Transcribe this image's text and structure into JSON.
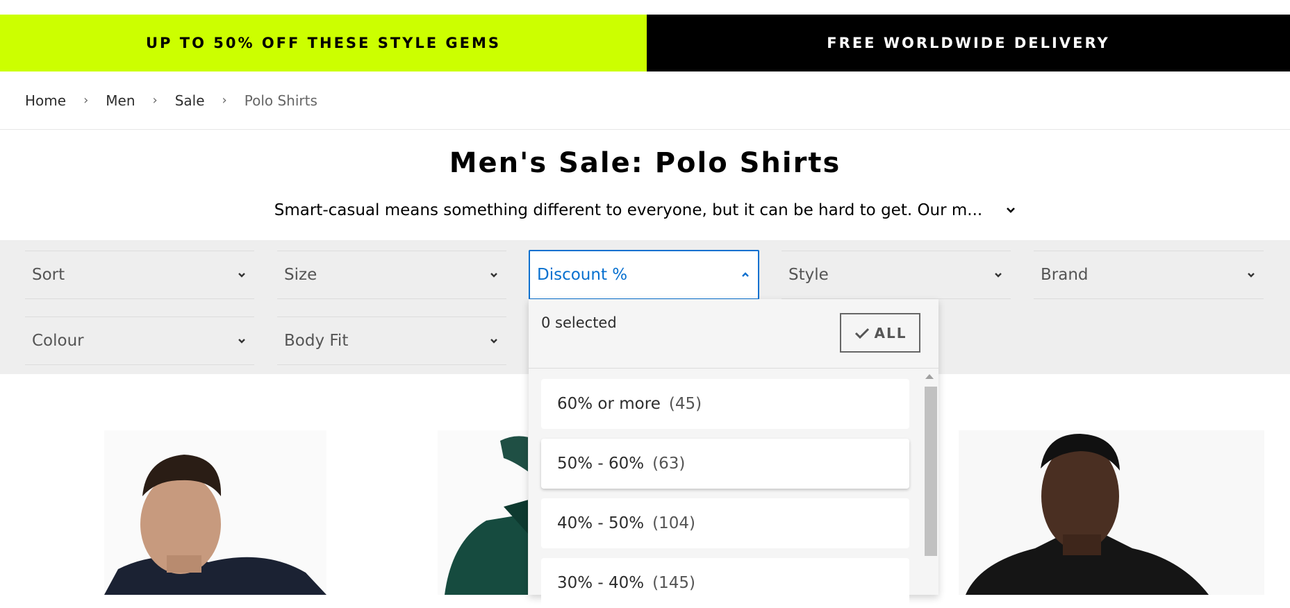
{
  "promo": {
    "left_text": "UP TO 50% OFF THESE STYLE GEMS",
    "right_text": "FREE WORLDWIDE DELIVERY",
    "left_bg": "#ccff00",
    "right_bg": "#000000"
  },
  "breadcrumb": {
    "items": [
      "Home",
      "Men",
      "Sale"
    ],
    "current": "Polo Shirts",
    "separator": "›"
  },
  "page": {
    "title": "Men's Sale: Polo Shirts",
    "description": "Smart-casual means something different to everyone, but it can be hard to get. Our m..."
  },
  "filters": {
    "sort": "Sort",
    "size": "Size",
    "discount": "Discount %",
    "style": "Style",
    "brand": "Brand",
    "colour": "Colour",
    "body_fit": "Body Fit"
  },
  "discount_dropdown": {
    "selected_count": "0 selected",
    "all_label": "ALL",
    "options": [
      {
        "label": "60% or more",
        "count": "(45)"
      },
      {
        "label": "50% - 60%",
        "count": "(63)"
      },
      {
        "label": "40% - 50%",
        "count": "(104)"
      },
      {
        "label": "30% - 40%",
        "count": "(145)"
      }
    ]
  },
  "accent_color": "#0770cf"
}
